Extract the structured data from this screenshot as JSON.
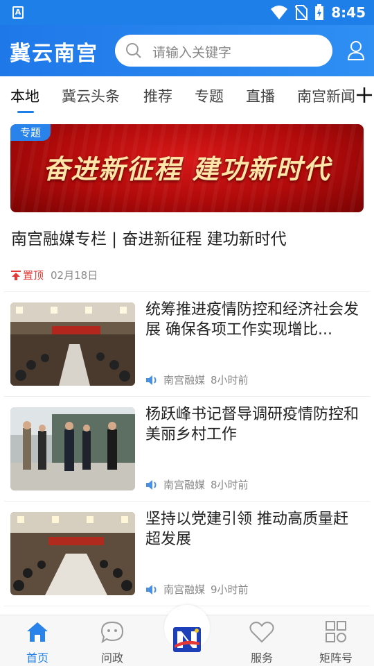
{
  "status_bar": {
    "time": "8:45",
    "app_badge": "A"
  },
  "header": {
    "app_title": "冀云南宫",
    "search_placeholder": "请输入关键字"
  },
  "tabs": [
    {
      "label": "本地"
    },
    {
      "label": "冀云头条"
    },
    {
      "label": "推荐"
    },
    {
      "label": "专题"
    },
    {
      "label": "直播"
    },
    {
      "label": "南宫新闻"
    }
  ],
  "add_tab": "+",
  "featured": {
    "tag": "专题",
    "banner_text": "奋进新征程 建功新时代",
    "title": "南宫融媒专栏 | 奋进新征程 建功新时代",
    "pin_label": "置顶",
    "date": "02月18日"
  },
  "news": [
    {
      "title": "统筹推进疫情防控和经济社会发展 确保各项工作实现增比...",
      "source": "南宫融媒",
      "time": "8小时前"
    },
    {
      "title": "杨跃峰书记督导调研疫情防控和美丽乡村工作",
      "source": "南宫融媒",
      "time": "8小时前"
    },
    {
      "title": "坚持以党建引领 推动高质量赶超发展",
      "source": "南宫融媒",
      "time": "9小时前"
    }
  ],
  "bottom_nav": [
    {
      "label": "首页"
    },
    {
      "label": "问政"
    },
    {
      "label": "服务"
    },
    {
      "label": "矩阵号"
    }
  ],
  "colors": {
    "brand": "#1f7fe8",
    "pin": "#e53935",
    "banner_red": "#b00a0a",
    "banner_text": "#ffe6a8"
  }
}
